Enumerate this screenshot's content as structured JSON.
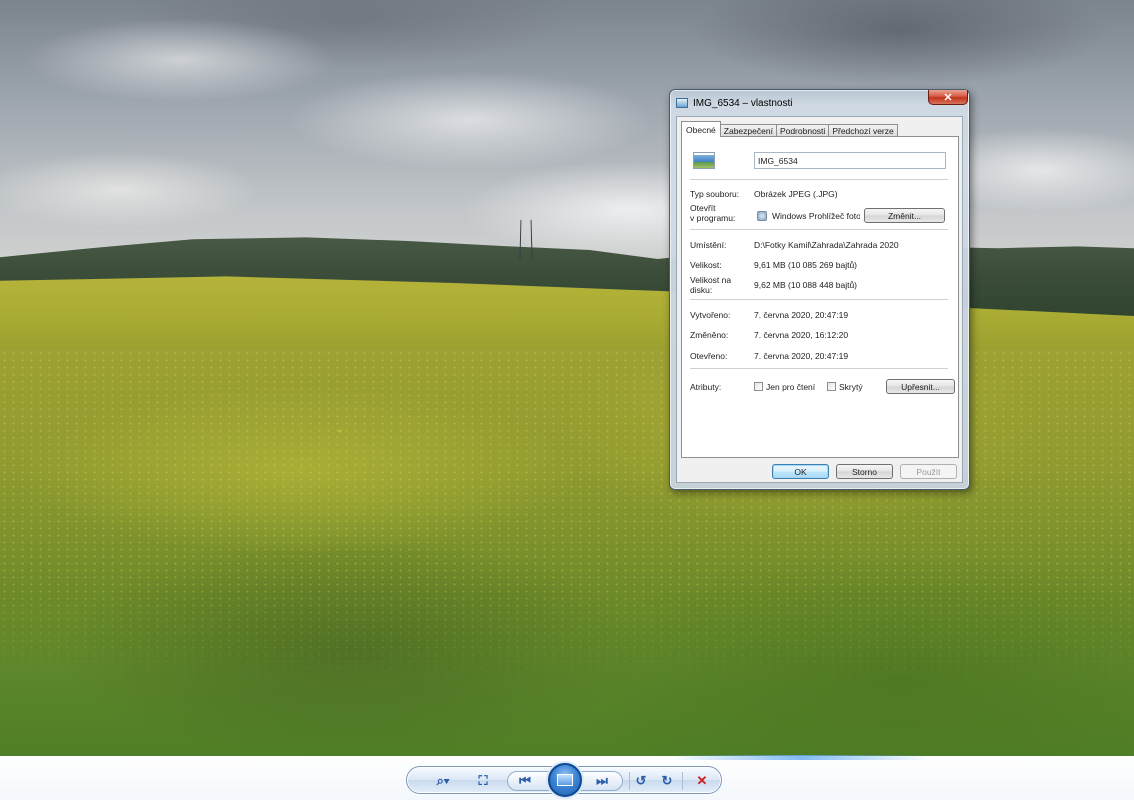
{
  "dialog": {
    "title": "IMG_6534 – vlastnosti",
    "close_glyph": "✕",
    "tabs": [
      "Obecné",
      "Zabezpečení",
      "Podrobnosti",
      "Předchozí verze"
    ],
    "file_name": "IMG_6534",
    "type_label": "Typ souboru:",
    "type_value": "Obrázek JPEG (.JPG)",
    "open_with_label_1": "Otevřít",
    "open_with_label_2": "v programu:",
    "open_with_value": "Windows Prohlížeč foto",
    "change_button": "Změnit...",
    "location_label": "Umístění:",
    "location_value": "D:\\Fotky Kamil\\Zahrada\\Zahrada 2020",
    "size_label": "Velikost:",
    "size_value": "9,61 MB (10 085 269 bajtů)",
    "disk_size_label_1": "Velikost na",
    "disk_size_label_2": "disku:",
    "disk_size_value": "9,62 MB (10 088 448 bajtů)",
    "created_label": "Vytvořeno:",
    "created_value": "7. června 2020, 20:47:19",
    "modified_label": "Změněno:",
    "modified_value": "7. června 2020, 16:12:20",
    "accessed_label": "Otevřeno:",
    "accessed_value": "7. června 2020, 20:47:19",
    "attributes_label": "Atributy:",
    "readonly_label": "Jen pro čtení",
    "readonly_checked": false,
    "hidden_label": "Skrytý",
    "hidden_checked": false,
    "advanced_button": "Upřesnit...",
    "ok_button": "OK",
    "cancel_button": "Storno",
    "apply_button": "Použít"
  },
  "viewer": {
    "zoom_glyph": "⌕▾",
    "fit_glyph": "⛶",
    "prev_glyph": "⏮",
    "next_glyph": "⏭",
    "rotate_left_glyph": "↺",
    "rotate_right_glyph": "↻",
    "delete_glyph": "✕"
  },
  "colors": {
    "accent": "#2b5ea8",
    "delete": "#cc2020"
  }
}
